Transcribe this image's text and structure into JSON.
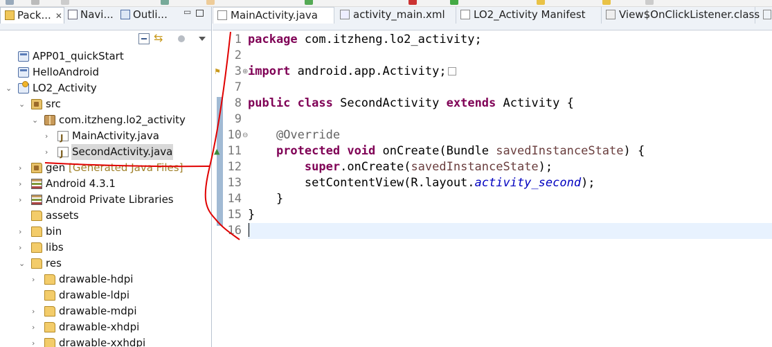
{
  "left_panel": {
    "tabs": [
      {
        "label": "Pack...",
        "icon": "package-explorer-icon",
        "close": "✕"
      },
      {
        "label": "Navi...",
        "icon": "navigator-icon"
      },
      {
        "label": "Outli...",
        "icon": "outline-icon"
      }
    ],
    "tree": [
      {
        "label": "APP01_quickStart",
        "icon": "project-icon",
        "expanded": null
      },
      {
        "label": "HelloAndroid",
        "icon": "project-icon",
        "expanded": null
      },
      {
        "label": "LO2_Activity",
        "icon": "android-project-icon",
        "expanded": true
      },
      {
        "label": "src",
        "icon": "source-folder-icon",
        "expanded": true
      },
      {
        "label": "com.itzheng.lo2_activity",
        "icon": "package-icon",
        "expanded": true
      },
      {
        "label": "MainActivity.java",
        "icon": "java-file-icon",
        "expanded": false
      },
      {
        "label": "SecondActivity.java",
        "icon": "java-file-icon",
        "expanded": false,
        "selected": true
      },
      {
        "label": "gen",
        "decoration": "[Generated Java Files]",
        "icon": "source-folder-icon",
        "expanded": false
      },
      {
        "label": "Android 4.3.1",
        "icon": "library-icon",
        "expanded": false
      },
      {
        "label": "Android Private Libraries",
        "icon": "library-icon",
        "expanded": false
      },
      {
        "label": "assets",
        "icon": "folder-icon",
        "expanded": null
      },
      {
        "label": "bin",
        "icon": "folder-icon",
        "expanded": false
      },
      {
        "label": "libs",
        "icon": "folder-icon",
        "expanded": false
      },
      {
        "label": "res",
        "icon": "folder-icon",
        "expanded": true
      },
      {
        "label": "drawable-hdpi",
        "icon": "folder-icon",
        "expanded": false
      },
      {
        "label": "drawable-ldpi",
        "icon": "folder-icon",
        "expanded": null
      },
      {
        "label": "drawable-mdpi",
        "icon": "folder-icon",
        "expanded": false
      },
      {
        "label": "drawable-xhdpi",
        "icon": "folder-icon",
        "expanded": false
      },
      {
        "label": "drawable-xxhdpi",
        "icon": "folder-icon",
        "expanded": false
      }
    ]
  },
  "editor": {
    "tabs": [
      {
        "label": "MainActivity.java",
        "icon": "java-file-icon",
        "active": true
      },
      {
        "label": "activity_main.xml",
        "icon": "xml-file-icon"
      },
      {
        "label": "LO2_Activity Manifest",
        "icon": "manifest-icon"
      },
      {
        "label": "View$OnClickListener.class",
        "icon": "class-file-icon"
      }
    ],
    "line_numbers": [
      "1",
      "2",
      "3",
      "7",
      "8",
      "9",
      "10",
      "11",
      "12",
      "13",
      "14",
      "15",
      "16"
    ],
    "code": {
      "l1_kw": "package",
      "l1_rest": " com.itzheng.lo2_activity;",
      "l3_kw": "import",
      "l3_rest": " android.app.Activity;",
      "l8_kw1": "public",
      "l8_kw2": "class",
      "l8_name": " SecondActivity ",
      "l8_kw3": "extends",
      "l8_rest": " Activity {",
      "l10_ann": "@Override",
      "l11_kw1": "protected",
      "l11_kw2": "void",
      "l11_sig": " onCreate(Bundle ",
      "l11_param": "savedInstanceState",
      "l11_end": ") {",
      "l12_kw": "super",
      "l12_call": ".onCreate(",
      "l12_param": "savedInstanceState",
      "l12_end": ");",
      "l13_call": "setContentView(R.layout.",
      "l13_field": "activity_second",
      "l13_end": ");",
      "l14": "    }",
      "l15": "}"
    }
  },
  "colors": {
    "keyword": "#7f0055",
    "annotation": "#646464",
    "static_field": "#0000c0",
    "ink": "#e00000"
  }
}
